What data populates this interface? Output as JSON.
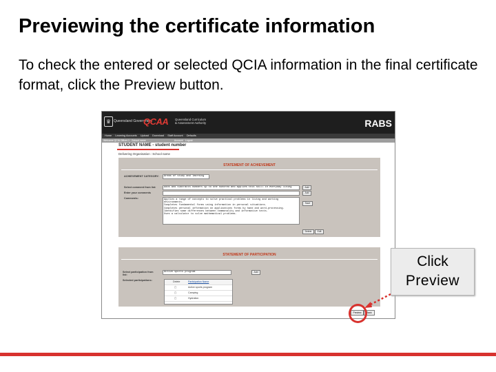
{
  "slide": {
    "title": "Previewing the certificate information",
    "intro": "To check the entered or selected QCIA information in the final certificate format, click the Preview button.",
    "accent_color": "#d8322e"
  },
  "screenshot": {
    "gov_text": "Queensland Government",
    "logo": "QCAA",
    "logo_sub": "Queensland Curriculum\n& Assessment Authority",
    "app_name": "RABS",
    "menu": [
      "Home",
      "Learning Accounts",
      "Upload",
      "Download",
      "Staff Account",
      "Defaults"
    ],
    "submenu": [
      "Welcome QCIA Officer 1",
      "School name",
      "Account",
      "Logout"
    ],
    "student_heading": "STUDENT NAME - student number",
    "org_line": "Delivering Organisation : School name",
    "achievement": {
      "heading": "STATEMENT OF ACHIEVEMENT",
      "category_label": "ACHIEVEMENT CATEGORY:",
      "category_value": "Areas of study and learning",
      "comment_select_label": "Select comment from list:",
      "comment_select_value": "Adds and subtracts numbers up to one hundred and applies this skill in everyday living",
      "enter_label": "Enter your comments",
      "comments_label": "Comments:",
      "comments_text": "Applies a range of concepts to solve practical problems in living and working\nenvironments.\nCompletes fundamental forms using information in personal situations.\nCompletes personal information on applications forms by hand and word-processing.\nIdentifies some differences between commonality and informative texts.\nUses a calculator to solve mathematical problems.",
      "add_label": "Add",
      "save_label": "Save",
      "delete_label": "Delete",
      "edit_label": "Edit"
    },
    "participation": {
      "heading": "STATEMENT OF PARTICIPATION",
      "select_label": "Select participation from list:",
      "select_value": "Active sports program",
      "add_label": "Add",
      "selected_label": "Selected participations:",
      "col_delete": "Delete",
      "col_name": "Participation Name",
      "rows": [
        "Active sports program",
        "Camping",
        "Hydration"
      ]
    },
    "preview_label": "Preview",
    "back_label": "Back"
  },
  "callout": {
    "line1": "Click",
    "line2": "Preview"
  }
}
